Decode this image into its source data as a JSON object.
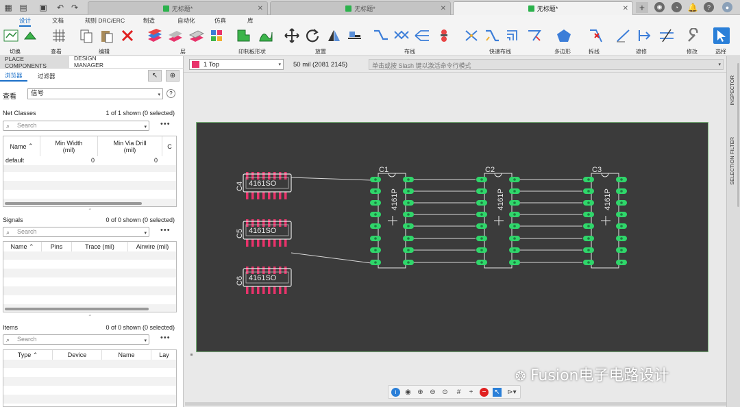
{
  "tabs": [
    {
      "label": "无标题*",
      "active": false
    },
    {
      "label": "无标题*",
      "active": false
    },
    {
      "label": "无标题*",
      "active": true
    }
  ],
  "ribbon": {
    "tabs": [
      "设计",
      "文档",
      "规则 DRC/ERC",
      "制造",
      "自动化",
      "仿真",
      "库"
    ],
    "groups": [
      "切换",
      "查看",
      "编辑",
      "层",
      "印制板形状",
      "放置",
      "布线",
      "快速布线",
      "多边形",
      "拆线",
      "遮修",
      "修改",
      "选择"
    ]
  },
  "left_panel": {
    "tabs": [
      "PLACE COMPONENTS",
      "DESIGN MANAGER"
    ],
    "subtabs": [
      "浏览器",
      "过滤器"
    ],
    "view_label": "查看",
    "view_value": "信号",
    "net_classes": {
      "title": "Net Classes",
      "count": "1 of 1 shown (0 selected)",
      "search_placeholder": "Search",
      "columns": [
        "Name",
        "Min Width\n(mil)",
        "Min Via Drill\n(mil)",
        "C"
      ],
      "rows": [
        [
          "default",
          "0",
          "0"
        ]
      ]
    },
    "signals": {
      "title": "Signals",
      "count": "0 of 0 shown (0 selected)",
      "search_placeholder": "Search",
      "columns": [
        "Name",
        "Pins",
        "Trace (mil)",
        "Airwire (mil)"
      ]
    },
    "items": {
      "title": "Items",
      "count": "0 of 0 shown (0 selected)",
      "search_placeholder": "Search",
      "columns": [
        "Type",
        "Device",
        "Name",
        "Lay"
      ]
    }
  },
  "options": {
    "layer": "1 Top",
    "layer_color": "#e8336b",
    "coords": "50 mil (2081 2145)",
    "command_placeholder": "单击或按 Slash 键以激活命令行模式"
  },
  "right_panels": [
    "INSPECTOR",
    "SELECTION FILTER"
  ],
  "components": {
    "smd": [
      {
        "ref": "C4",
        "label": "4161SO"
      },
      {
        "ref": "C5",
        "label": "4161SO"
      },
      {
        "ref": "C6",
        "label": "4161SO"
      }
    ],
    "dip": [
      {
        "ref": "C1",
        "label": "4161P"
      },
      {
        "ref": "C2",
        "label": "4161P"
      },
      {
        "ref": "C3",
        "label": "4161P"
      }
    ]
  },
  "colors": {
    "board": "#3b3b3b",
    "pad": "#2fd66a",
    "smd_pad": "#e8336b",
    "accent": "#1a6fc8"
  },
  "watermark": "Fusion电子电路设计"
}
